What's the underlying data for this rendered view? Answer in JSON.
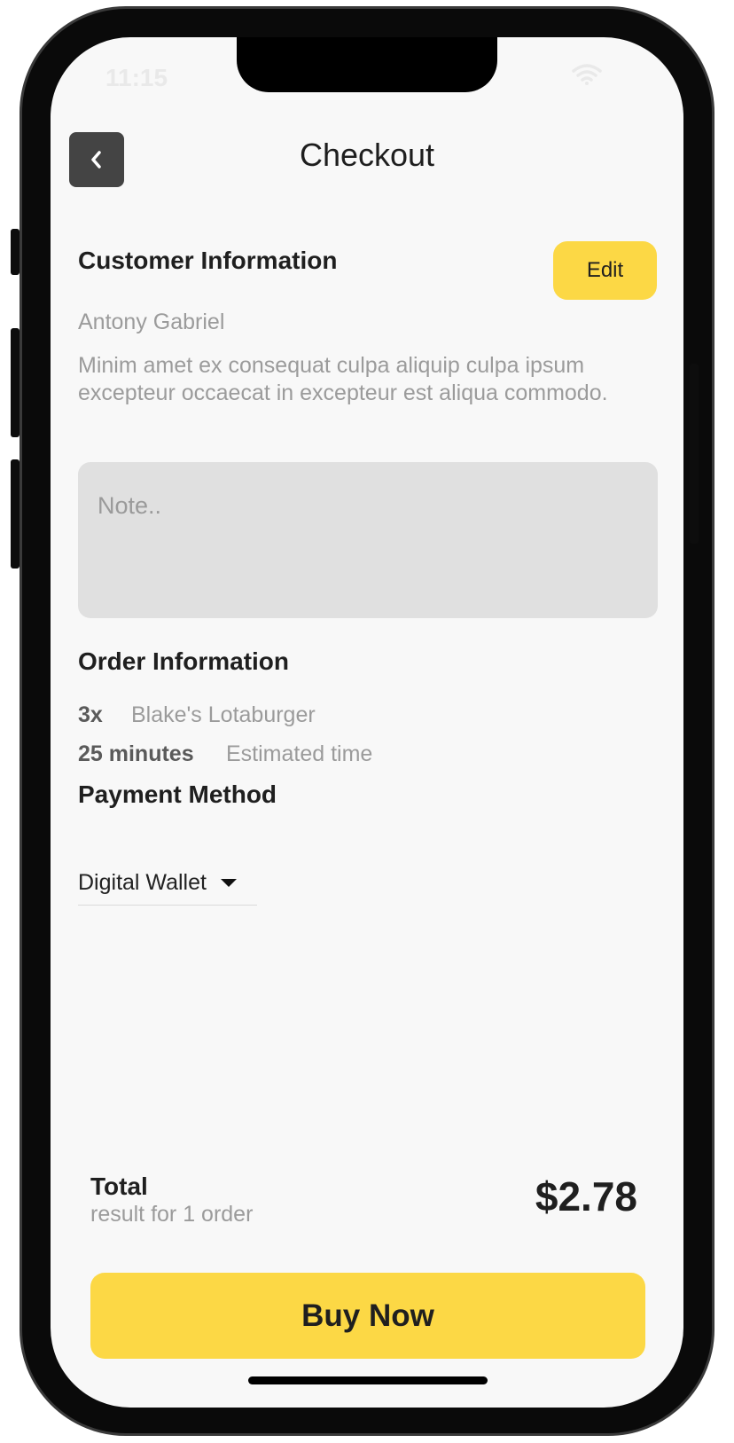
{
  "status_bar": {
    "time": "11:15",
    "wifi_icon": "wifi-icon"
  },
  "header": {
    "back_icon": "chevron-left-icon",
    "title": "Checkout"
  },
  "customer": {
    "title": "Customer Information",
    "edit_label": "Edit",
    "name": "Antony Gabriel",
    "address": "Minim amet ex consequat culpa aliquip culpa ipsum excepteur occaecat in excepteur est aliqua commodo.",
    "note_placeholder": "Note..",
    "note_value": ""
  },
  "order": {
    "title": "Order Information",
    "quantity": "3x",
    "item_name": "Blake's Lotaburger",
    "time_value": "25 minutes",
    "time_label": "Estimated time"
  },
  "payment": {
    "title": "Payment Method",
    "selected": "Digital Wallet",
    "caret_icon": "caret-down-icon"
  },
  "summary": {
    "total_label": "Total",
    "total_sub": "result for 1 order",
    "total_amount": "$2.78"
  },
  "actions": {
    "buy_label": "Buy Now"
  },
  "colors": {
    "accent": "#fcd845",
    "back_button": "#444444",
    "background": "#f8f8f8",
    "note_background": "#e0e0e0"
  }
}
